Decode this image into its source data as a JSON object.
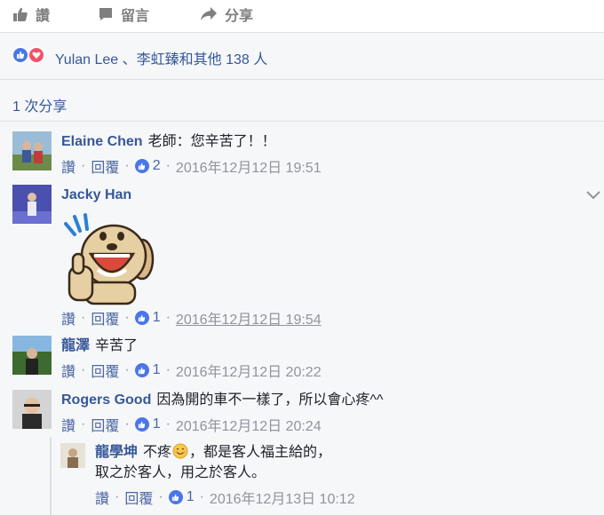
{
  "actions": {
    "like": "讚",
    "comment": "留言",
    "share": "分享"
  },
  "reactions": {
    "text": "Yulan Lee 、李虹臻和其他 138 人"
  },
  "shares": {
    "text": "1 次分享"
  },
  "colors": {
    "link": "#365899",
    "like_blue": "#4a76e8",
    "love_red": "#f25268",
    "meta_gray": "#90949c"
  },
  "comments": [
    {
      "author": "Elaine Chen",
      "text": "老師：您辛苦了！！",
      "like": "讚",
      "reply": "回覆",
      "likes": "2",
      "time": "2016年12月12日 19:51"
    },
    {
      "author": "Jacky Han",
      "text": "",
      "like": "讚",
      "reply": "回覆",
      "likes": "1",
      "time": "2016年12月12日 19:54",
      "sticker": "thumbs-up-dog-sticker"
    },
    {
      "author": "龍澤",
      "text": "辛苦了",
      "like": "讚",
      "reply": "回覆",
      "likes": "1",
      "time": "2016年12月12日 20:22"
    },
    {
      "author": "Rogers Good",
      "text": "因為開的車不一樣了，所以會心疼^^",
      "like": "讚",
      "reply": "回覆",
      "likes": "1",
      "time": "2016年12月12日 20:24"
    }
  ],
  "reply": {
    "author": "龍學坤",
    "text_before": "不疼",
    "emoji": "smiling-face",
    "text_after": "，都是客人福主給的，",
    "line2": "取之於客人，用之於客人。",
    "like": "讚",
    "reply": "回覆",
    "likes": "1",
    "time": "2016年12月13日 10:12"
  }
}
